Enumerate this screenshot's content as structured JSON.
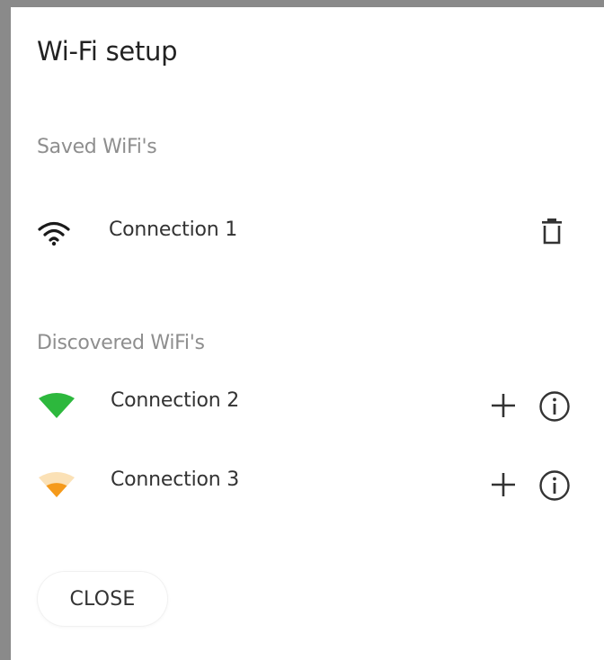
{
  "dialog": {
    "title": "Wi-Fi setup",
    "close_label": "CLOSE"
  },
  "saved": {
    "heading": "Saved WiFi's",
    "items": [
      {
        "name": "Connection 1",
        "signal_icon": "wifi-full-icon",
        "action_icon": "trash-icon"
      }
    ]
  },
  "discovered": {
    "heading": "Discovered WiFi's",
    "items": [
      {
        "name": "Connection 2",
        "signal_icon": "wifi-strong-icon",
        "signal_color": "#2db83d",
        "actions": [
          "add-icon",
          "info-icon"
        ]
      },
      {
        "name": "Connection 3",
        "signal_icon": "wifi-medium-icon",
        "signal_color": "#f59a1b",
        "actions": [
          "add-icon",
          "info-icon"
        ]
      }
    ]
  }
}
